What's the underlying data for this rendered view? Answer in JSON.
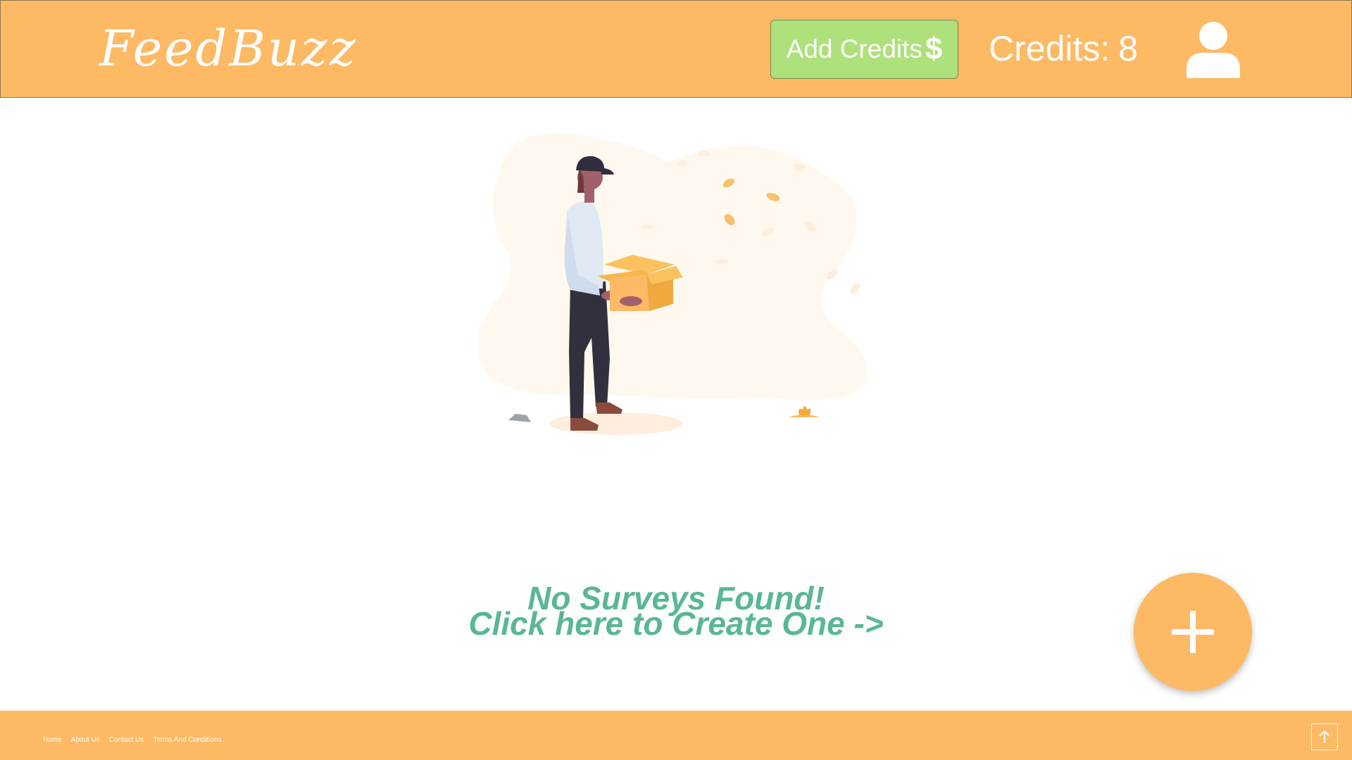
{
  "header": {
    "logo": "FeedBuzz",
    "add_credits_label": "Add Credits",
    "add_credits_icon": "dollar-icon",
    "add_credits_symbol": "$",
    "credits_label": "Credits:",
    "credits_value": "8",
    "avatar_icon": "user-icon"
  },
  "main": {
    "illustration": "empty-box-illustration",
    "empty_line1": "No Surveys Found!",
    "empty_line2": "Click here to Create One ->",
    "fab_icon": "plus-icon"
  },
  "footer": {
    "links": [
      "Home",
      "About Us",
      "Contact Us",
      "Terms And Conditions"
    ],
    "scroll_top_icon": "arrow-up-icon"
  },
  "colors": {
    "brand": "#fdb964",
    "accent_green": "#aee07b",
    "message_green": "#59b792"
  }
}
